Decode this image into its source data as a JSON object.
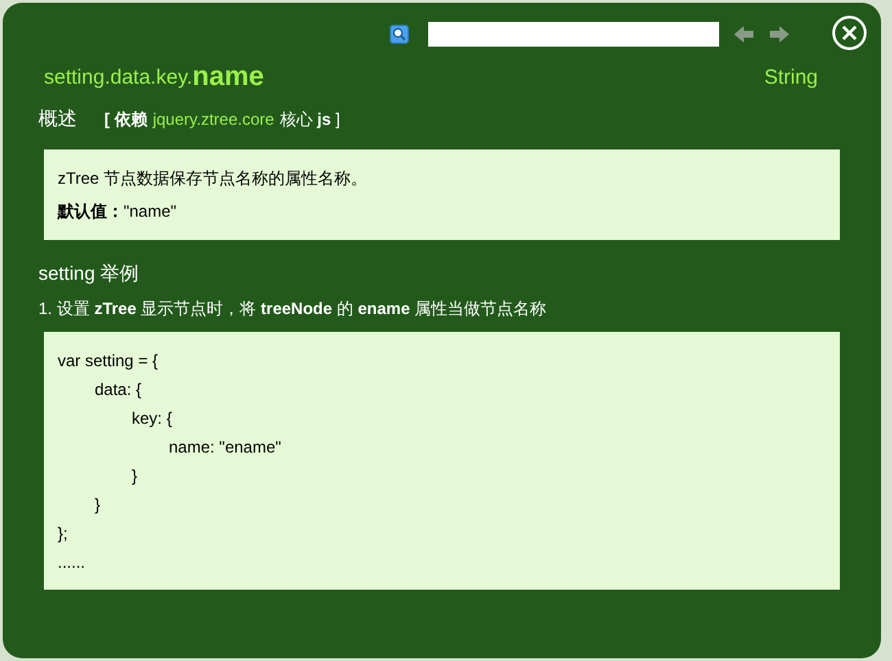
{
  "header": {
    "path": "setting.data.key.",
    "name": "name",
    "type": "String"
  },
  "overview": {
    "label": "概述",
    "dependency_open": "[ 依赖",
    "dependency_link": "jquery.ztree.core",
    "dependency_close": "核心 **js** ]"
  },
  "description": [
    "zTree 节点数据保存节点名称的属性名称。",
    "**默认值：**\"name\""
  ],
  "example": {
    "title": "setting 举例",
    "caption": "1. 设置 **zTree** 显示节点时，将 **treeNode** 的 **ename** 属性当做节点名称",
    "code": [
      {
        "text": "var setting = {",
        "children": [
          {
            "text": "data: {",
            "children": [
              {
                "text": "key: {",
                "children": [
                  {
                    "text": "name: \"ename\""
                  }
                ]
              },
              {
                "text": "}"
              }
            ]
          },
          {
            "text": "}"
          }
        ]
      },
      {
        "text": "};"
      },
      {
        "text": "......"
      }
    ]
  }
}
